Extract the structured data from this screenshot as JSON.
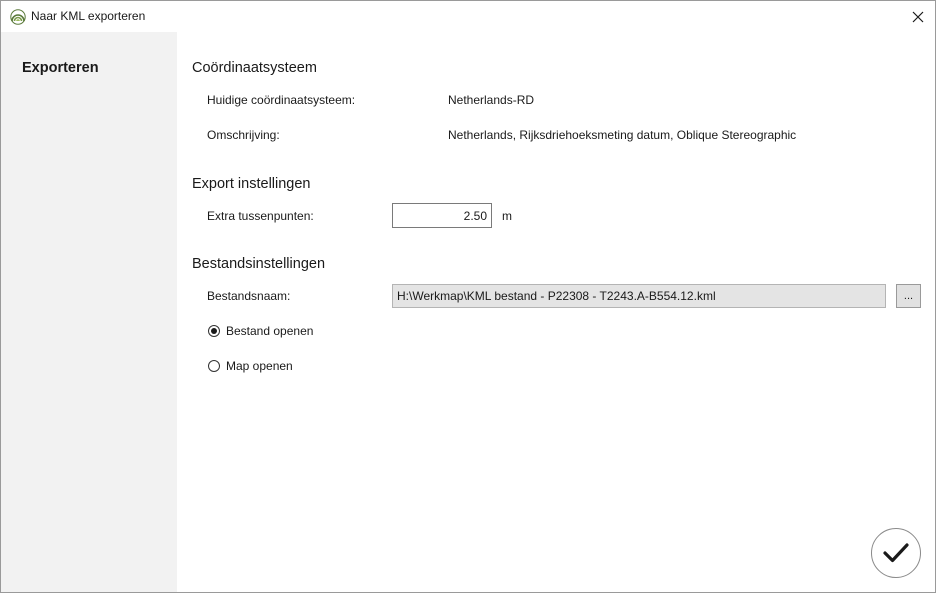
{
  "window": {
    "title": "Naar KML exporteren"
  },
  "sidebar": {
    "items": [
      {
        "label": "Exporteren",
        "active": true
      }
    ]
  },
  "coordinate_system": {
    "section_title": "Coördinaatsysteem",
    "current_label": "Huidige coördinaatsysteem:",
    "current_value": "Netherlands-RD",
    "description_label": "Omschrijving:",
    "description_value": "Netherlands, Rijksdriehoeksmeting datum, Oblique Stereographic"
  },
  "export_settings": {
    "section_title": "Export instellingen",
    "extra_points_label": "Extra tussenpunten:",
    "extra_points_value": "2.50",
    "extra_points_unit": "m"
  },
  "file_settings": {
    "section_title": "Bestandsinstellingen",
    "filename_label": "Bestandsnaam:",
    "filename_value": "H:\\Werkmap\\KML bestand - P22308 - T2243.A-B554.12.kml",
    "browse_label": "...",
    "options": [
      {
        "label": "Bestand openen",
        "selected": true
      },
      {
        "label": "Map openen",
        "selected": false
      }
    ]
  },
  "icons": {
    "app": "kml-app-icon",
    "close": "close-icon",
    "confirm": "checkmark-icon"
  },
  "colors": {
    "sidebar_bg": "#f2f2f2",
    "app_icon": "#5a7a3a"
  }
}
